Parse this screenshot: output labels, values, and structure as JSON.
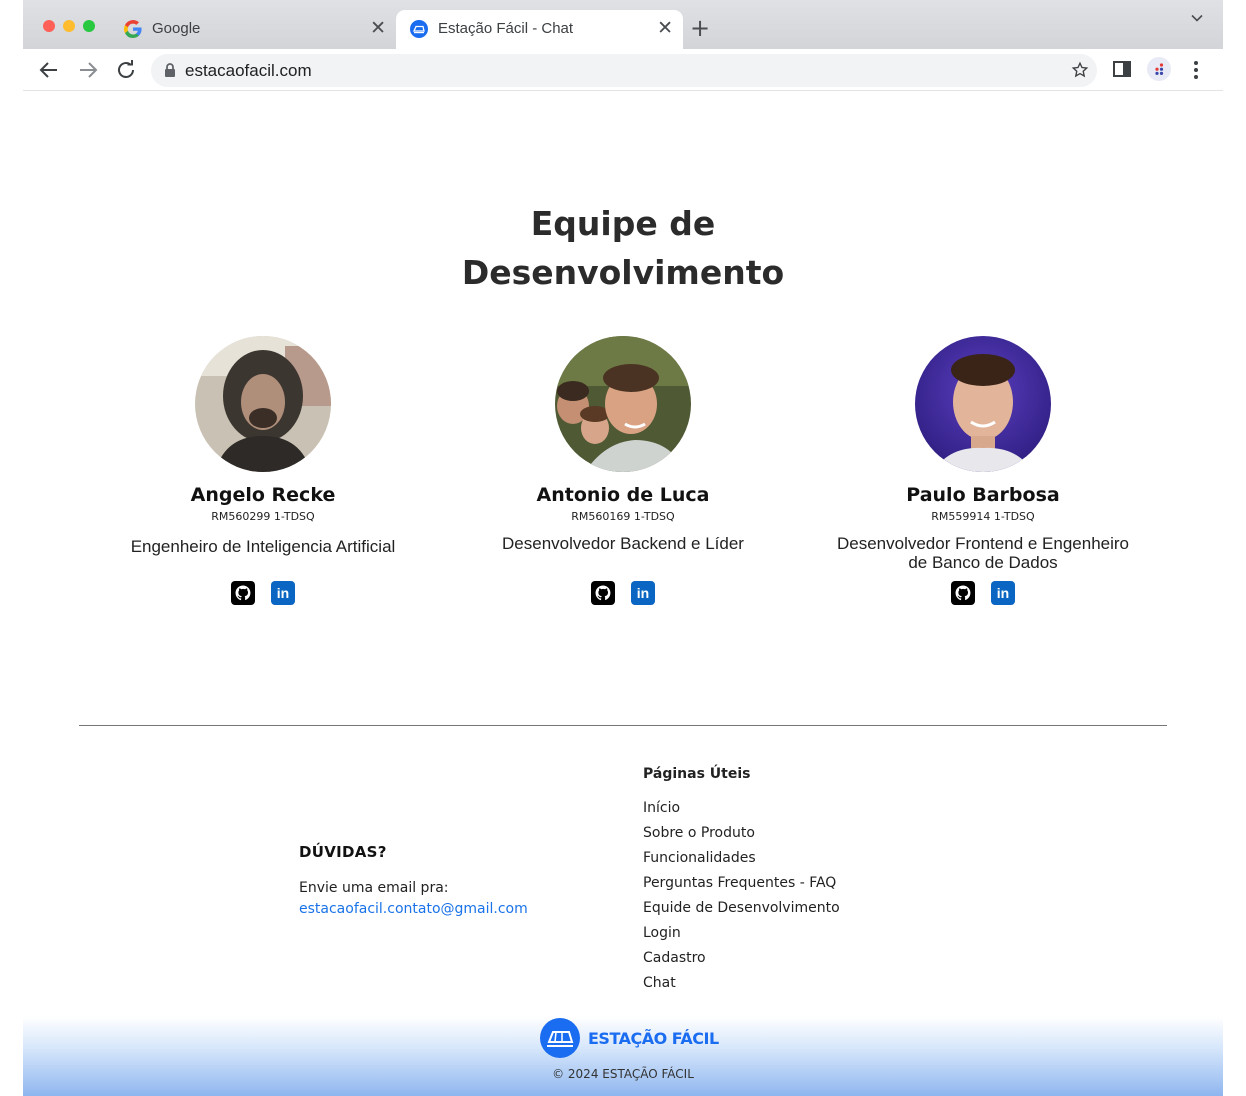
{
  "browser": {
    "tabs": [
      {
        "title": "Google",
        "close": "✕",
        "active": false
      },
      {
        "title": "Estação Fácil - Chat",
        "close": "✕",
        "active": true
      }
    ],
    "new_tab": "+",
    "url": "estacaofacil.com"
  },
  "team": {
    "title_line1": "Equipe de",
    "title_line2": "Desenvolvimento",
    "members": [
      {
        "name": "Angelo Recke",
        "rm": "RM560299 1-TDSQ",
        "role": "Engenheiro de Inteligencia Artificial"
      },
      {
        "name": "Antonio de Luca",
        "rm": "RM560169 1-TDSQ",
        "role": "Desenvolvedor Backend e Líder"
      },
      {
        "name": "Paulo Barbosa",
        "rm": "RM559914 1-TDSQ",
        "role": "Desenvolvedor Frontend e Engenheiro de Banco de Dados"
      }
    ],
    "linkedin_label": "in"
  },
  "footer": {
    "contact_heading": "DÚVIDAS?",
    "contact_text": "Envie uma email pra:",
    "contact_email": "estacaofacil.contato@gmail.com",
    "links_heading": "Páginas Úteis",
    "links": [
      "Início",
      "Sobre o Produto",
      "Funcionalidades",
      "Perguntas Frequentes - FAQ",
      "Equide de Desenvolvimento",
      "Login",
      "Cadastro",
      "Chat"
    ],
    "brand_name": "ESTAÇÃO FÁCIL",
    "copyright": "© 2024 ESTAÇÃO FÁCIL"
  },
  "colors": {
    "accent": "#1a6cf0",
    "link": "#1a73e8",
    "linkedin": "#0a66c2"
  }
}
